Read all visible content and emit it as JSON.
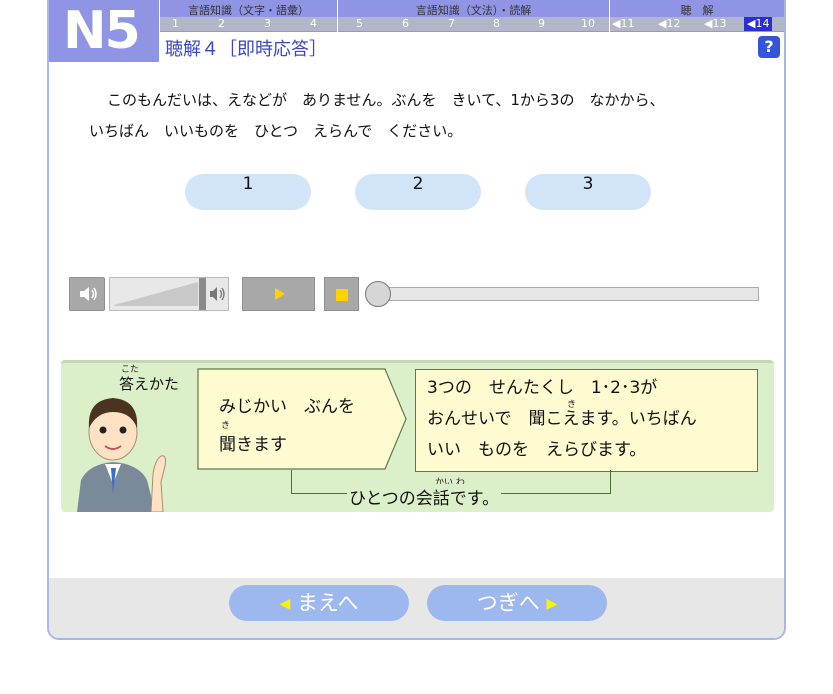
{
  "header": {
    "level_badge": "N5",
    "sections": [
      {
        "label": "言語知識（文字・語彙）",
        "numbers": [
          "1",
          "2",
          "3",
          "4"
        ]
      },
      {
        "label": "言語知識（文法）・読解",
        "numbers": [
          "5",
          "6",
          "7",
          "8",
          "9",
          "10"
        ]
      },
      {
        "label": "聴　解",
        "numbers": [
          "◀11",
          "◀12",
          "◀13",
          "◀14"
        ]
      }
    ],
    "active_question": "◀14",
    "title": "聴解４［即時応答］",
    "help_label": "?"
  },
  "instructions": {
    "line1": "このもんだいは、えなどが　ありません。ぶんを　きいて、1から3の　なかから、",
    "line2": "いちばん　いいものを　ひとつ　えらんで　ください。"
  },
  "options": [
    "1",
    "2",
    "3"
  ],
  "player": {
    "volume_level": 0.75,
    "seek_position": 0.0,
    "colors": {
      "play_triangle": "#ffd200",
      "stop_square": "#ffd200"
    }
  },
  "explanation": {
    "label": "答えかた",
    "label_ruby": "こた",
    "box1_line1": "みじかい　ぶんを",
    "box1_line2": "聞きます",
    "box1_ruby": "き",
    "box2_line1": "3つの　せんたくし　1･2･3が",
    "box2_line2": "おんせいで　聞こえます。いちばん",
    "box2_line3": "いい　ものを　えらびます。",
    "box2_ruby": "き",
    "bracket_label": "ひとつの会話です。",
    "bracket_ruby": "かい わ"
  },
  "footer": {
    "prev_label": "まえへ",
    "next_label": "つぎへ",
    "prev_arrow": "◀",
    "next_arrow": "▶"
  },
  "colors": {
    "header_bg": "#8f95e4",
    "title_text": "#3a47c5",
    "option_bg": "#d2e4f8",
    "panel_bg": "#dbf0c8",
    "box_bg": "#fffbd0",
    "nav_button": "#9cb8ef"
  }
}
